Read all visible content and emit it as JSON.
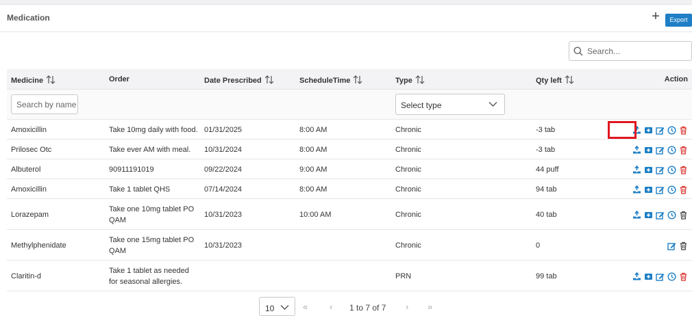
{
  "panel": {
    "title": "Medication",
    "add_label": "+",
    "export_label": "Export"
  },
  "search": {
    "placeholder": "Search..."
  },
  "table": {
    "columns": {
      "medicine": "Medicine",
      "order": "Order",
      "date": "Date Prescribed",
      "schedule": "ScheduleTime",
      "type": "Type",
      "qty": "Qty left",
      "action": "Action"
    },
    "filters": {
      "name_placeholder": "Search by name",
      "type_selected": "Select type"
    },
    "rows": [
      {
        "medicine": "Amoxicillin",
        "order": [
          "Take 10mg daily with food."
        ],
        "date": "01/31/2025",
        "schedule": "8:00 AM",
        "type": "Chronic",
        "qty": "-3 tab",
        "actions": [
          "dispense",
          "add",
          "edit",
          "schedule",
          "delete"
        ]
      },
      {
        "medicine": "Prilosec Otc",
        "order": [
          "Take ever AM with meal."
        ],
        "date": "10/31/2024",
        "schedule": "8:00 AM",
        "type": "Chronic",
        "qty": "-3 tab",
        "actions": [
          "dispense",
          "add",
          "edit",
          "schedule",
          "delete"
        ]
      },
      {
        "medicine": "Albuterol",
        "order": [
          "90911191019"
        ],
        "date": "09/22/2024",
        "schedule": "9:00 AM",
        "type": "Chronic",
        "qty": "44 puff",
        "actions": [
          "dispense",
          "add",
          "edit",
          "schedule",
          "delete"
        ]
      },
      {
        "medicine": "Amoxicillin",
        "order": [
          "Take 1 tablet QHS"
        ],
        "date": "07/14/2024",
        "schedule": "8:00 AM",
        "type": "Chronic",
        "qty": "94 tab",
        "actions": [
          "dispense",
          "add",
          "edit",
          "schedule",
          "delete"
        ]
      },
      {
        "medicine": "Lorazepam",
        "order": [
          "Take one 10mg tablet PO",
          "QAM"
        ],
        "date": "10/31/2023",
        "schedule": "10:00 AM",
        "type": "Chronic",
        "qty": "40 tab",
        "actions": [
          "dispense",
          "add",
          "edit",
          "schedule",
          "delete-dark"
        ]
      },
      {
        "medicine": "Methylphenidate",
        "order": [
          "Take one 15mg tablet PO",
          "QAM"
        ],
        "date": "10/31/2023",
        "schedule": "",
        "type": "Chronic",
        "qty": "0",
        "actions": [
          "edit",
          "delete-dark"
        ]
      },
      {
        "medicine": "Claritin-d",
        "order": [
          "Take 1 tablet as needed",
          "for seasonal allergies."
        ],
        "date": "",
        "schedule": "",
        "type": "PRN",
        "qty": "99 tab",
        "actions": [
          "dispense",
          "add",
          "edit",
          "schedule",
          "delete"
        ]
      }
    ]
  },
  "pagination": {
    "page_size": "10",
    "info": "1 to 7 of 7",
    "first": "«",
    "prev": "‹",
    "next": "›",
    "last": "»"
  },
  "colors": {
    "accent": "#1e7fc6",
    "delete": "#d9302c",
    "highlight": "#e0161e"
  }
}
